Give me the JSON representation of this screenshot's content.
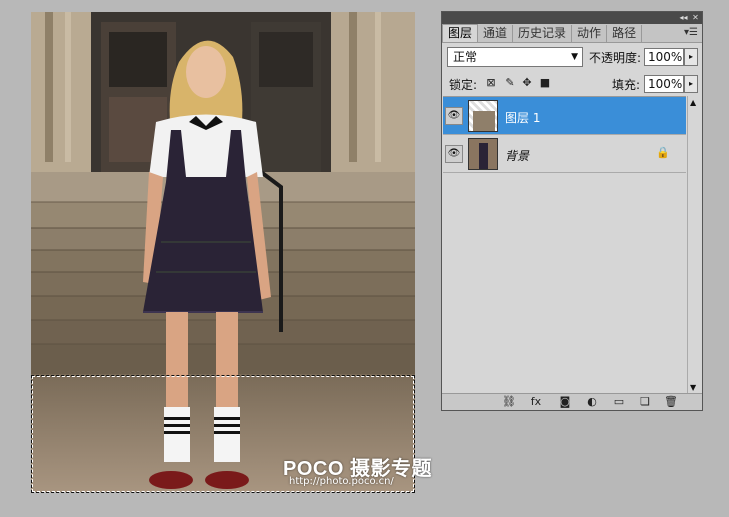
{
  "layers_panel": {
    "tabs": [
      {
        "label": "图层"
      },
      {
        "label": "通道"
      },
      {
        "label": "历史记录"
      },
      {
        "label": "动作"
      },
      {
        "label": "路径"
      }
    ],
    "blend_mode": "正常",
    "opacity_label": "不透明度:",
    "opacity_value": "100%",
    "lock_label": "锁定:",
    "fill_label": "填充:",
    "fill_value": "100%",
    "layers": [
      {
        "name": "图层 1",
        "selected": true,
        "visible": true,
        "locked": false
      },
      {
        "name": "背景",
        "selected": false,
        "visible": true,
        "locked": true
      }
    ]
  },
  "watermark": {
    "main": "POCO 摄影专题",
    "url": "http://photo.poco.cn/"
  },
  "colors": {
    "selection_highlight": "#3a8ed8",
    "workspace_bg": "#b8b8b8",
    "panel_bg": "#d6d6d6"
  }
}
